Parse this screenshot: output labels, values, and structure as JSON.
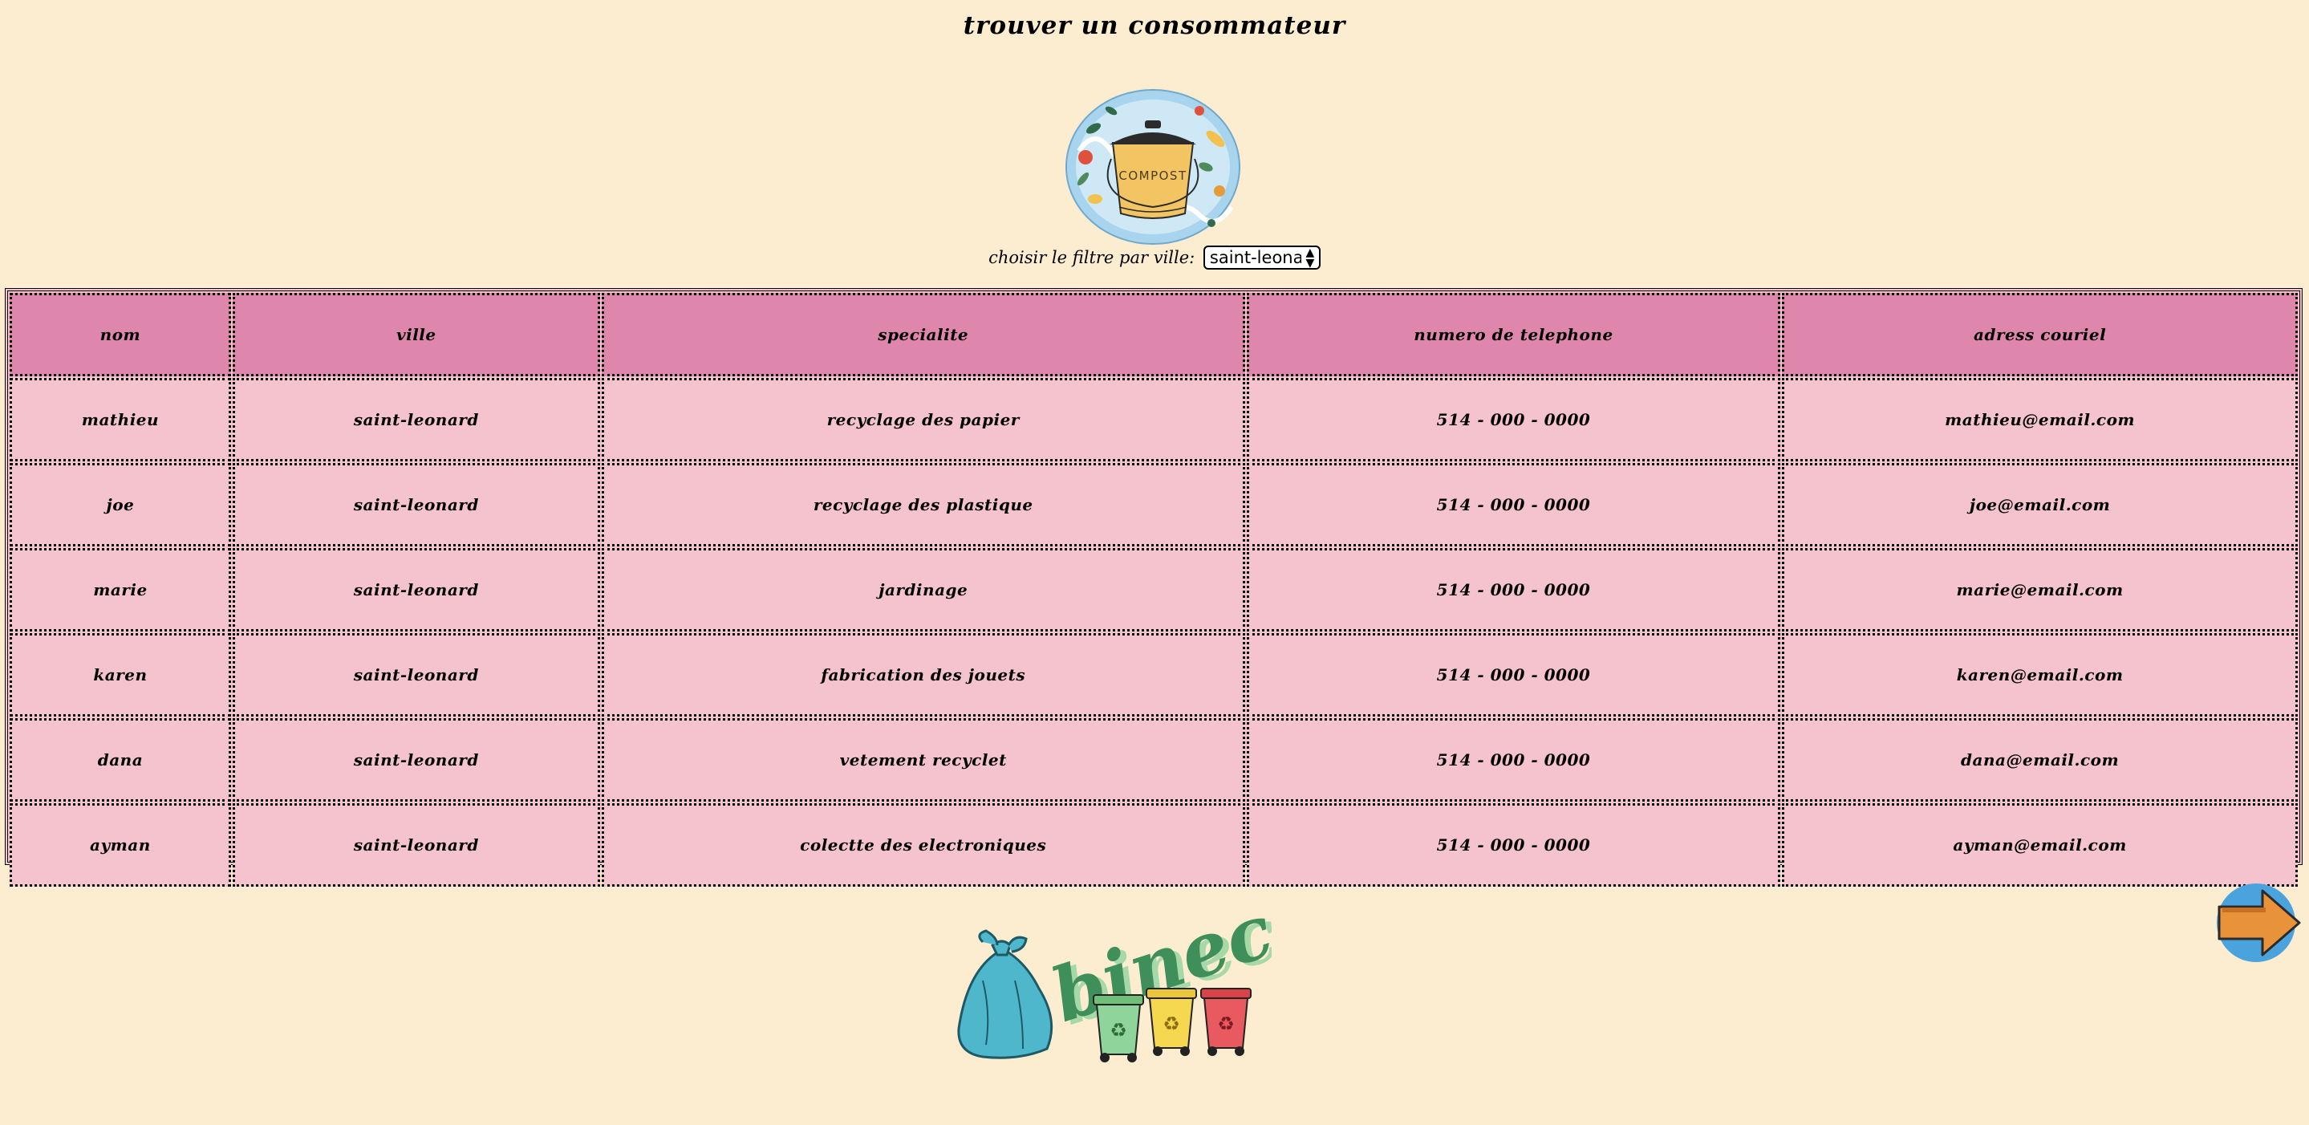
{
  "page": {
    "title": "trouver un consommateur"
  },
  "compost_logo": {
    "label": "COMPOST"
  },
  "filter": {
    "label": "choisir le filtre par ville:",
    "selected": "saint-leonard"
  },
  "table": {
    "headers": [
      "nom",
      "ville",
      "specialite",
      "numero de telephone",
      "adress couriel"
    ],
    "rows": [
      [
        "mathieu",
        "saint-leonard",
        "recyclage des papier",
        "514 - 000 - 0000",
        "mathieu@email.com"
      ],
      [
        "joe",
        "saint-leonard",
        "recyclage des plastique",
        "514 - 000 - 0000",
        "joe@email.com"
      ],
      [
        "marie",
        "saint-leonard",
        "jardinage",
        "514 - 000 - 0000",
        "marie@email.com"
      ],
      [
        "karen",
        "saint-leonard",
        "fabrication des jouets",
        "514 - 000 - 0000",
        "karen@email.com"
      ],
      [
        "dana",
        "saint-leonard",
        "vetement recyclet",
        "514 - 000 - 0000",
        "dana@email.com"
      ],
      [
        "ayman",
        "saint-leonard",
        "colectte des electroniques",
        "514 - 000 - 0000",
        "ayman@email.com"
      ]
    ]
  },
  "bineco_logo": {
    "wordmark": "bineco"
  },
  "icons": {
    "next": "arrow-right-icon",
    "recycle": "recycle-icon"
  },
  "colors": {
    "background": "#fcedd0",
    "header_cell": "#df86ad",
    "body_cell": "#f5c3cd",
    "arrow_circle": "#4aa3dc",
    "arrow_fill": "#e8923a"
  }
}
